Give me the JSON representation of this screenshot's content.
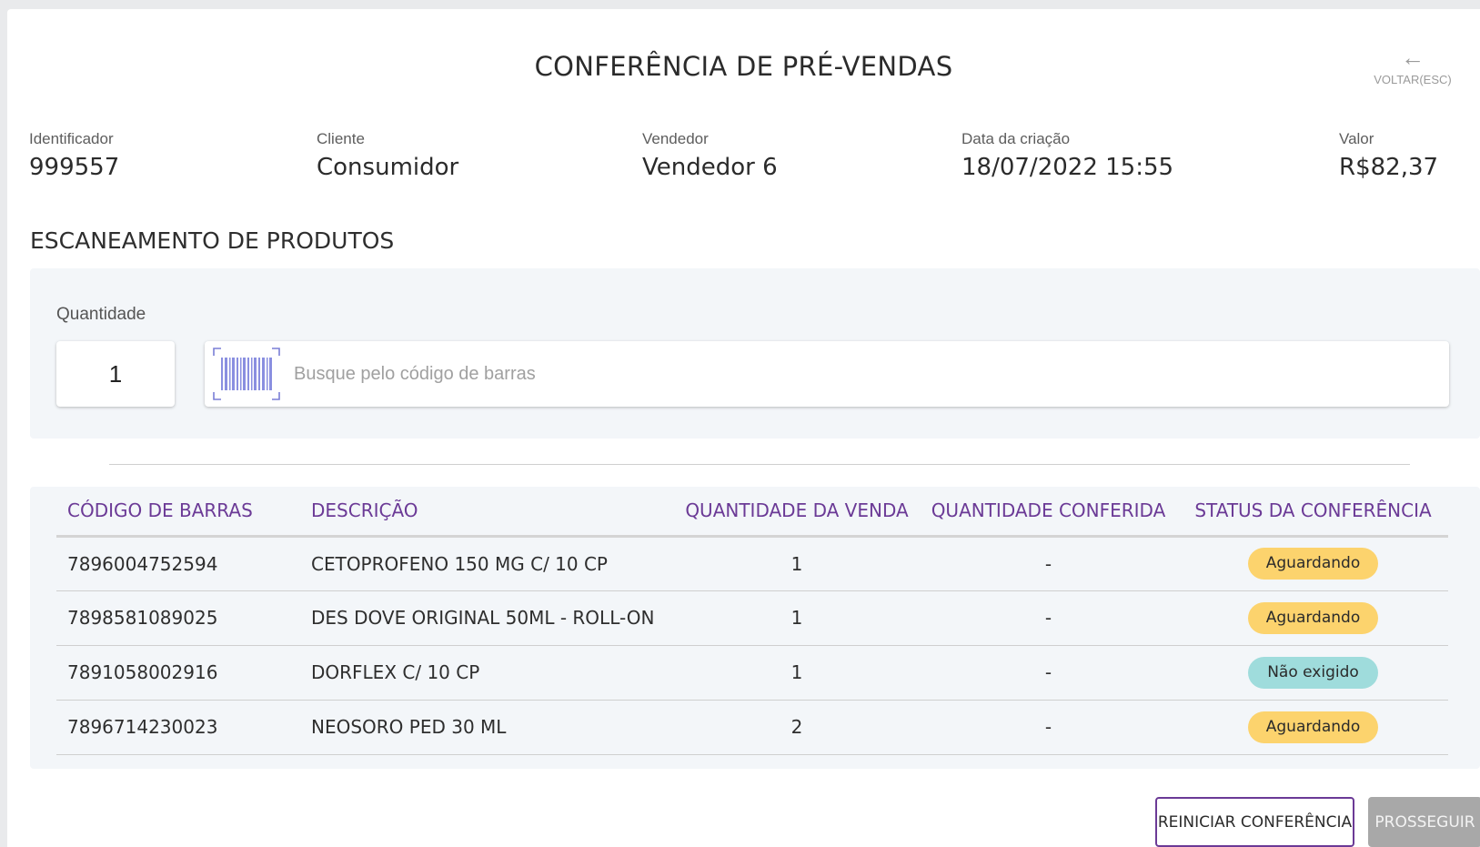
{
  "header": {
    "title": "CONFERÊNCIA DE PRÉ-VENDAS",
    "back_label": "VOLTAR(ESC)",
    "back_icon": "arrow-left-icon"
  },
  "info": {
    "identifier": {
      "label": "Identificador",
      "value": "999557"
    },
    "client": {
      "label": "Cliente",
      "value": "Consumidor"
    },
    "seller": {
      "label": "Vendedor",
      "value": "Vendedor 6"
    },
    "created": {
      "label": "Data da criação",
      "value": "18/07/2022 15:55"
    },
    "amount": {
      "label": "Valor",
      "value": "R$82,37"
    }
  },
  "scan": {
    "section_title": "ESCANEAMENTO DE PRODUTOS",
    "quantity_label": "Quantidade",
    "quantity_value": "1",
    "search_placeholder": "Busque pelo código de barras",
    "barcode_icon": "barcode-scan-icon"
  },
  "table": {
    "headers": [
      "CÓDIGO DE BARRAS",
      "DESCRIÇÃO",
      "QUANTIDADE DA VENDA",
      "QUANTIDADE CONFERIDA",
      "STATUS DA CONFERÊNCIA"
    ],
    "rows": [
      {
        "barcode": "7896004752594",
        "description": "CETOPROFENO 150 MG C/ 10 CP",
        "qty_sale": "1",
        "qty_checked": "-",
        "status": "Aguardando"
      },
      {
        "barcode": "7898581089025",
        "description": "DES DOVE ORIGINAL 50ML - ROLL-ON",
        "qty_sale": "1",
        "qty_checked": "-",
        "status": "Aguardando"
      },
      {
        "barcode": "7891058002916",
        "description": "DORFLEX C/ 10 CP",
        "qty_sale": "1",
        "qty_checked": "-",
        "status": "Não exigido"
      },
      {
        "barcode": "7896714230023",
        "description": "NEOSORO PED 30 ML",
        "qty_sale": "2",
        "qty_checked": "-",
        "status": "Aguardando"
      }
    ]
  },
  "actions": {
    "reset_label": "REINICIAR CONFERÊNCIA",
    "proceed_label": "PROSSEGUIR"
  },
  "colors": {
    "accent": "#6b3a96",
    "status_waiting": "#fcd36d",
    "status_not_required": "#9fdcdc",
    "disabled_button": "#a8a8a8"
  }
}
